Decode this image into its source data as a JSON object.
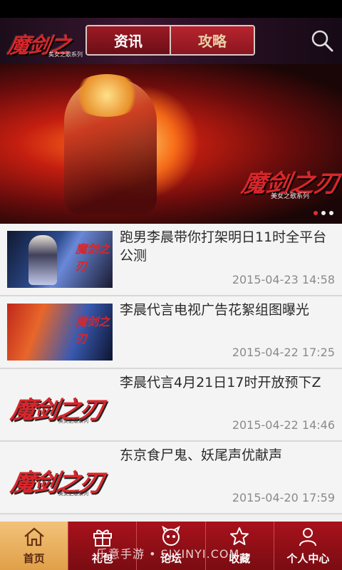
{
  "header": {
    "logo_text": "魔剑之刃",
    "logo_sub": "美女之歌系列",
    "tabs": [
      {
        "label": "资讯"
      },
      {
        "label": "攻略"
      }
    ],
    "search_icon": "search-icon"
  },
  "banner": {
    "logo_text": "魔剑之刃",
    "logo_sub": "美女之歌系列",
    "page_count": 3,
    "active_page": 1
  },
  "news": [
    {
      "title": "跑男李晨带你打架明日11时全平台公测",
      "date": "2015-04-23 14:58"
    },
    {
      "title": "李晨代言电视广告花絮组图曝光",
      "date": "2015-04-22 17:25"
    },
    {
      "title": "李晨代言4月21日17时开放预下Z",
      "date": "2015-04-22 14:46"
    },
    {
      "title": "东京食尸鬼、妖尾声优献声",
      "date": "2015-04-20 17:59"
    }
  ],
  "thumb_labels": {
    "logo": "魔剑之刃",
    "sub": "美女之歌系列",
    "small": "魔剑之刃"
  },
  "tabbar": [
    {
      "label": "首页",
      "icon": "home-icon"
    },
    {
      "label": "礼包",
      "icon": "gift-icon"
    },
    {
      "label": "论坛",
      "icon": "forum-icon"
    },
    {
      "label": "收藏",
      "icon": "star-icon"
    },
    {
      "label": "个人中心",
      "icon": "person-icon"
    }
  ],
  "watermark": "乐意手游 • SJXINYI.COM"
}
